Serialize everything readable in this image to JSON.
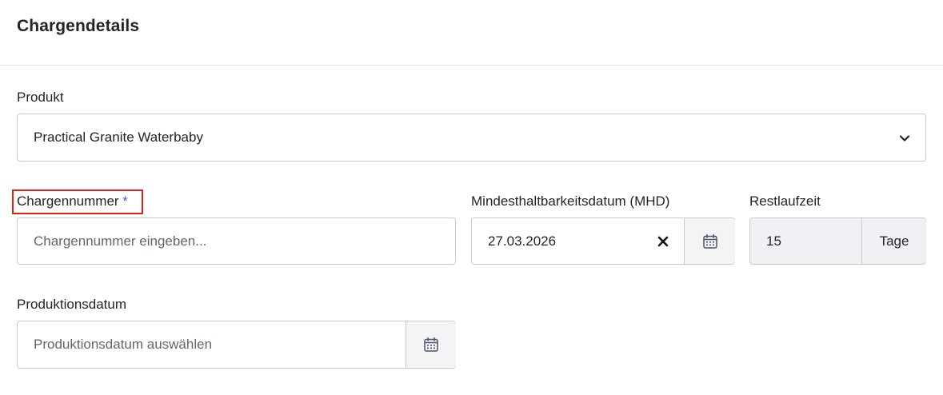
{
  "header": {
    "title": "Chargendetails"
  },
  "produkt": {
    "label": "Produkt",
    "selected_value": "Practical Granite Waterbaby",
    "icon": "chevron-down-icon"
  },
  "chargennummer": {
    "label": "Chargennummer",
    "required_marker": "*",
    "placeholder": "Chargennummer eingeben..."
  },
  "mhd": {
    "label": "Mindesthaltbarkeitsdatum (MHD)",
    "value": "27.03.2026",
    "clear_icon": "close-icon",
    "calendar_icon": "calendar-icon"
  },
  "restlaufzeit": {
    "label": "Restlaufzeit",
    "value": "15",
    "unit": "Tage"
  },
  "produktionsdatum": {
    "label": "Produktionsdatum",
    "placeholder": "Produktionsdatum auswählen",
    "calendar_icon": "calendar-icon"
  },
  "colors": {
    "highlight_border": "#e0201b",
    "required_marker": "#3a66c4",
    "readonly_background": "#eef0f4"
  }
}
